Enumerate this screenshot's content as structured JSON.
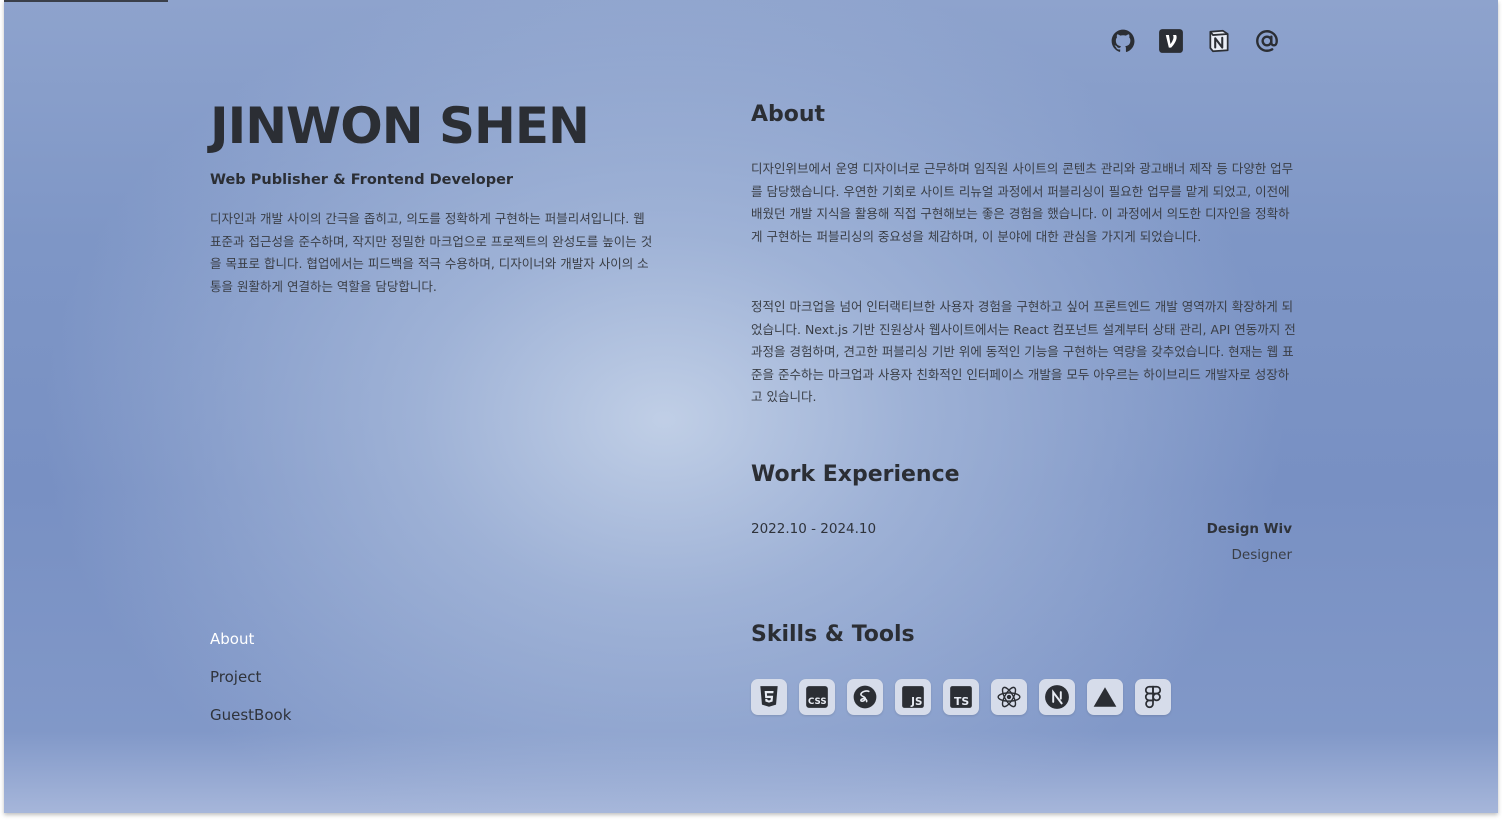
{
  "social": [
    {
      "name": "github-icon"
    },
    {
      "name": "velog-icon"
    },
    {
      "name": "notion-icon"
    },
    {
      "name": "email-icon"
    }
  ],
  "profile": {
    "name": "JINWON SHEN",
    "role": "Web Publisher & Frontend Developer",
    "intro": "디자인과 개발 사이의 간극을 좁히고, 의도를 정확하게 구현하는 퍼블리셔입니다. 웹 표준과 접근성을 준수하며, 작지만 정밀한 마크업으로 프로젝트의 완성도를 높이는 것을 목표로 합니다. 협업에서는 피드백을 적극 수용하며, 디자이너와 개발자 사이의 소통을 원활하게 연결하는 역할을 담당합니다."
  },
  "nav": {
    "items": [
      {
        "label": "About"
      },
      {
        "label": "Project"
      },
      {
        "label": "GuestBook"
      }
    ]
  },
  "about": {
    "title": "About",
    "p1": "디자인위브에서 운영 디자이너로 근무하며 임직원 사이트의 콘텐츠 관리와 광고배너 제작 등 다양한 업무를 담당했습니다. 우연한 기회로 사이트 리뉴얼 과정에서 퍼블리싱이 필요한 업무를 맡게 되었고, 이전에 배웠던 개발 지식을 활용해 직접 구현해보는 좋은 경험을 했습니다. 이 과정에서 의도한 디자인을 정확하게 구현하는 퍼블리싱의 중요성을 체감하며, 이 분야에 대한 관심을 가지게 되었습니다.",
    "p2": "정적인 마크업을 넘어 인터랙티브한 사용자 경험을 구현하고 싶어 프론트엔드 개발 영역까지 확장하게 되었습니다. Next.js 기반 진원상사 웹사이트에서는 React 컴포넌트 설계부터 상태 관리, API 연동까지 전 과정을 경험하며, 견고한 퍼블리싱 기반 위에 동적인 기능을 구현하는 역량을 갖추었습니다. 현재는 웹 표준을 준수하는 마크업과 사용자 친화적인 인터페이스 개발을 모두 아우르는 하이브리드 개발자로 성장하고 있습니다."
  },
  "work": {
    "title": "Work Experience",
    "period": "2022.10 - 2024.10",
    "company": "Design Wiv",
    "role": "Designer"
  },
  "skills": {
    "title": "Skills & Tools",
    "items": [
      {
        "name": "html5-icon"
      },
      {
        "name": "css3-icon"
      },
      {
        "name": "sass-icon"
      },
      {
        "name": "javascript-icon"
      },
      {
        "name": "typescript-icon"
      },
      {
        "name": "react-icon"
      },
      {
        "name": "nextjs-icon"
      },
      {
        "name": "vercel-icon"
      },
      {
        "name": "figma-icon"
      }
    ]
  },
  "colors": {
    "background": "#7e96c6",
    "text": "#2b2e34",
    "nav_active": "#ffffff",
    "skill_tile": "#d6dcea"
  }
}
